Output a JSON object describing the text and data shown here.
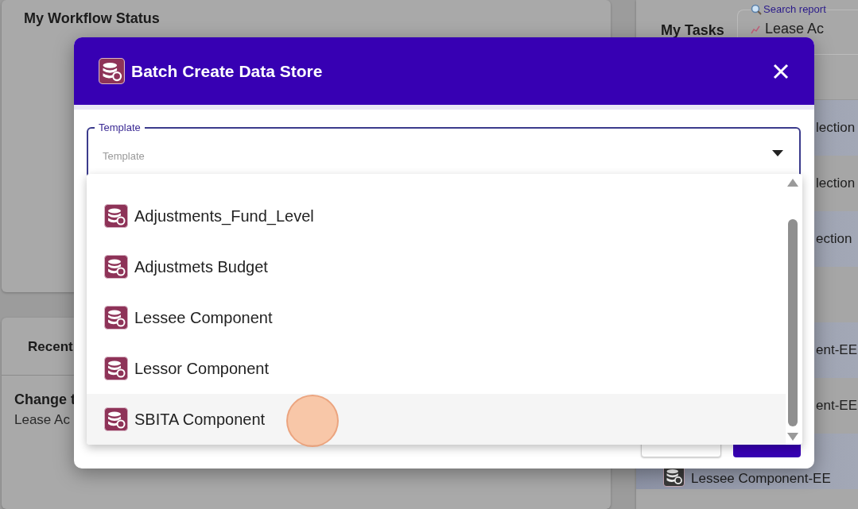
{
  "background": {
    "workflow_card": {
      "title": "My Workflow Status"
    },
    "recent_card": {
      "tab": "Recent",
      "item_title": "Change t",
      "item_subtitle": "Lease Ac"
    },
    "tasks_panel": {
      "title": "My Tasks",
      "search_link": "Search report",
      "report": "Lease Ac",
      "rows": [
        {
          "kind": "text",
          "text": "lection",
          "shaded": true
        },
        {
          "kind": "text",
          "text": "lection",
          "shaded": false
        },
        {
          "kind": "text",
          "text": "ection",
          "shaded": true
        },
        {
          "kind": "blank",
          "shaded": false
        },
        {
          "kind": "text",
          "text": "ent-EE",
          "shaded": true
        },
        {
          "kind": "text",
          "text": "ent-EE",
          "shaded": false
        },
        {
          "kind": "icon",
          "text": "Lessee Component-EE",
          "shaded": true
        }
      ]
    }
  },
  "dialog": {
    "title": "Batch Create Data Store",
    "template_field": {
      "label": "Template",
      "placeholder": "Template",
      "expanded": true
    },
    "options": [
      {
        "label": "Adjustments_Fund_Level",
        "highlighted": false
      },
      {
        "label": "Adjustmets Budget",
        "highlighted": false
      },
      {
        "label": "Lessee Component",
        "highlighted": false
      },
      {
        "label": "Lessor Component",
        "highlighted": false
      },
      {
        "label": "SBITA Component",
        "highlighted": true
      }
    ]
  }
}
